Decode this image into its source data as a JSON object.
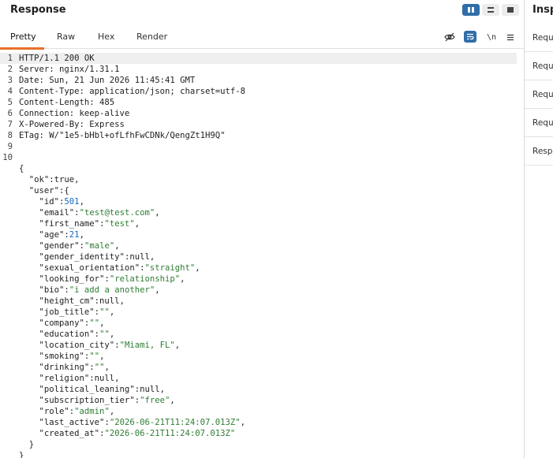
{
  "panel": {
    "title": "Response"
  },
  "tabs": [
    {
      "label": "Pretty"
    },
    {
      "label": "Raw"
    },
    {
      "label": "Hex"
    },
    {
      "label": "Render"
    }
  ],
  "tools": {
    "newline_label": "\\n"
  },
  "inspector": {
    "title": "Inspector",
    "items": [
      {
        "label": "Request attributes"
      },
      {
        "label": "Request query parameters"
      },
      {
        "label": "Request body parameters"
      },
      {
        "label": "Request cookies"
      },
      {
        "label": "Response headers"
      }
    ]
  },
  "icons": {
    "layout": [
      "split-horizontal-icon",
      "split-vertical-icon",
      "single-pane-icon"
    ],
    "tools": [
      "eye-slash-icon",
      "wrap-icon",
      "newline-icon",
      "menu-icon"
    ]
  },
  "colors": {
    "accent": "#2f6ea8",
    "tab_underline": "#e8702a",
    "string": "#2e7d32",
    "number": "#1565c0"
  },
  "lines": [
    {
      "num": "1",
      "tokens": [
        {
          "t": "HTTP/1.1 200 OK",
          "c": "p"
        }
      ]
    },
    {
      "num": "2",
      "tokens": [
        {
          "t": "Server: nginx/1.31.1",
          "c": "p"
        }
      ]
    },
    {
      "num": "3",
      "tokens": [
        {
          "t": "Date: Sun, 21 Jun 2026 11:45:41 GMT",
          "c": "p"
        }
      ]
    },
    {
      "num": "4",
      "tokens": [
        {
          "t": "Content-Type: application/json; charset=utf-8",
          "c": "p"
        }
      ]
    },
    {
      "num": "5",
      "tokens": [
        {
          "t": "Content-Length: 485",
          "c": "p"
        }
      ]
    },
    {
      "num": "6",
      "tokens": [
        {
          "t": "Connection: keep-alive",
          "c": "p"
        }
      ]
    },
    {
      "num": "7",
      "tokens": [
        {
          "t": "X-Powered-By: Express",
          "c": "p"
        }
      ]
    },
    {
      "num": "8",
      "tokens": [
        {
          "t": "ETag: W/\"1e5-bHbl+ofLfhFwCDNk/QengZt1H9Q\"",
          "c": "p"
        }
      ]
    },
    {
      "num": "9",
      "tokens": []
    },
    {
      "num": "10",
      "tokens": []
    },
    {
      "num": "",
      "tokens": [
        {
          "t": "{",
          "c": "p"
        }
      ]
    },
    {
      "num": "",
      "tokens": [
        {
          "t": "  \"ok\"",
          "c": "k"
        },
        {
          "t": ":true,",
          "c": "p"
        }
      ]
    },
    {
      "num": "",
      "tokens": [
        {
          "t": "  \"user\"",
          "c": "k"
        },
        {
          "t": ":{",
          "c": "p"
        }
      ]
    },
    {
      "num": "",
      "tokens": [
        {
          "t": "    \"id\"",
          "c": "k"
        },
        {
          "t": ":",
          "c": "p"
        },
        {
          "t": "501",
          "c": "n"
        },
        {
          "t": ",",
          "c": "p"
        }
      ]
    },
    {
      "num": "",
      "tokens": [
        {
          "t": "    \"email\"",
          "c": "k"
        },
        {
          "t": ":",
          "c": "p"
        },
        {
          "t": "\"test@test.com\"",
          "c": "s"
        },
        {
          "t": ",",
          "c": "p"
        }
      ]
    },
    {
      "num": "",
      "tokens": [
        {
          "t": "    \"first_name\"",
          "c": "k"
        },
        {
          "t": ":",
          "c": "p"
        },
        {
          "t": "\"test\"",
          "c": "s"
        },
        {
          "t": ",",
          "c": "p"
        }
      ]
    },
    {
      "num": "",
      "tokens": [
        {
          "t": "    \"age\"",
          "c": "k"
        },
        {
          "t": ":",
          "c": "p"
        },
        {
          "t": "21",
          "c": "n"
        },
        {
          "t": ",",
          "c": "p"
        }
      ]
    },
    {
      "num": "",
      "tokens": [
        {
          "t": "    \"gender\"",
          "c": "k"
        },
        {
          "t": ":",
          "c": "p"
        },
        {
          "t": "\"male\"",
          "c": "s"
        },
        {
          "t": ",",
          "c": "p"
        }
      ]
    },
    {
      "num": "",
      "tokens": [
        {
          "t": "    \"gender_identity\"",
          "c": "k"
        },
        {
          "t": ":null,",
          "c": "p"
        }
      ]
    },
    {
      "num": "",
      "tokens": [
        {
          "t": "    \"sexual_orientation\"",
          "c": "k"
        },
        {
          "t": ":",
          "c": "p"
        },
        {
          "t": "\"straight\"",
          "c": "s"
        },
        {
          "t": ",",
          "c": "p"
        }
      ]
    },
    {
      "num": "",
      "tokens": [
        {
          "t": "    \"looking_for\"",
          "c": "k"
        },
        {
          "t": ":",
          "c": "p"
        },
        {
          "t": "\"relationship\"",
          "c": "s"
        },
        {
          "t": ",",
          "c": "p"
        }
      ]
    },
    {
      "num": "",
      "tokens": [
        {
          "t": "    \"bio\"",
          "c": "k"
        },
        {
          "t": ":",
          "c": "p"
        },
        {
          "t": "\"i add a another\"",
          "c": "s"
        },
        {
          "t": ",",
          "c": "p"
        }
      ]
    },
    {
      "num": "",
      "tokens": [
        {
          "t": "    \"height_cm\"",
          "c": "k"
        },
        {
          "t": ":null,",
          "c": "p"
        }
      ]
    },
    {
      "num": "",
      "tokens": [
        {
          "t": "    \"job_title\"",
          "c": "k"
        },
        {
          "t": ":",
          "c": "p"
        },
        {
          "t": "\"\"",
          "c": "s"
        },
        {
          "t": ",",
          "c": "p"
        }
      ]
    },
    {
      "num": "",
      "tokens": [
        {
          "t": "    \"company\"",
          "c": "k"
        },
        {
          "t": ":",
          "c": "p"
        },
        {
          "t": "\"\"",
          "c": "s"
        },
        {
          "t": ",",
          "c": "p"
        }
      ]
    },
    {
      "num": "",
      "tokens": [
        {
          "t": "    \"education\"",
          "c": "k"
        },
        {
          "t": ":",
          "c": "p"
        },
        {
          "t": "\"\"",
          "c": "s"
        },
        {
          "t": ",",
          "c": "p"
        }
      ]
    },
    {
      "num": "",
      "tokens": [
        {
          "t": "    \"location_city\"",
          "c": "k"
        },
        {
          "t": ":",
          "c": "p"
        },
        {
          "t": "\"Miami, FL\"",
          "c": "s"
        },
        {
          "t": ",",
          "c": "p"
        }
      ]
    },
    {
      "num": "",
      "tokens": [
        {
          "t": "    \"smoking\"",
          "c": "k"
        },
        {
          "t": ":",
          "c": "p"
        },
        {
          "t": "\"\"",
          "c": "s"
        },
        {
          "t": ",",
          "c": "p"
        }
      ]
    },
    {
      "num": "",
      "tokens": [
        {
          "t": "    \"drinking\"",
          "c": "k"
        },
        {
          "t": ":",
          "c": "p"
        },
        {
          "t": "\"\"",
          "c": "s"
        },
        {
          "t": ",",
          "c": "p"
        }
      ]
    },
    {
      "num": "",
      "tokens": [
        {
          "t": "    \"religion\"",
          "c": "k"
        },
        {
          "t": ":null,",
          "c": "p"
        }
      ]
    },
    {
      "num": "",
      "tokens": [
        {
          "t": "    \"political_leaning\"",
          "c": "k"
        },
        {
          "t": ":null,",
          "c": "p"
        }
      ]
    },
    {
      "num": "",
      "tokens": [
        {
          "t": "    \"subscription_tier\"",
          "c": "k"
        },
        {
          "t": ":",
          "c": "p"
        },
        {
          "t": "\"free\"",
          "c": "s"
        },
        {
          "t": ",",
          "c": "p"
        }
      ]
    },
    {
      "num": "",
      "tokens": [
        {
          "t": "    \"role\"",
          "c": "k"
        },
        {
          "t": ":",
          "c": "p"
        },
        {
          "t": "\"admin\"",
          "c": "s"
        },
        {
          "t": ",",
          "c": "p"
        }
      ]
    },
    {
      "num": "",
      "tokens": [
        {
          "t": "    \"last_active\"",
          "c": "k"
        },
        {
          "t": ":",
          "c": "p"
        },
        {
          "t": "\"2026-06-21T11:24:07.013Z\"",
          "c": "s"
        },
        {
          "t": ",",
          "c": "p"
        }
      ]
    },
    {
      "num": "",
      "tokens": [
        {
          "t": "    \"created_at\"",
          "c": "k"
        },
        {
          "t": ":",
          "c": "p"
        },
        {
          "t": "\"2026-06-21T11:24:07.013Z\"",
          "c": "s"
        }
      ]
    },
    {
      "num": "",
      "tokens": [
        {
          "t": "  }",
          "c": "p"
        }
      ]
    },
    {
      "num": "",
      "tokens": [
        {
          "t": "}",
          "c": "p"
        }
      ]
    }
  ]
}
